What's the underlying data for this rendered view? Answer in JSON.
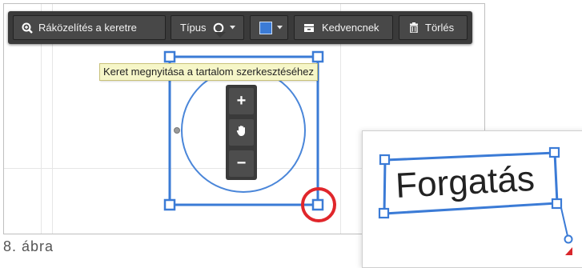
{
  "toolbar": {
    "zoom_label": "Ráközelítés a keretre",
    "type_label": "Típus",
    "favorite_label": "Kedvencnek",
    "delete_label": "Törlés",
    "fill_color": "#3b7bd6"
  },
  "tooltip": {
    "text": "Keret megnyitása a tartalom szerkesztéséhez"
  },
  "zoom_control": {
    "plus": "+",
    "minus": "−"
  },
  "inset": {
    "text": "Forgatás"
  },
  "caption": "8. ábra",
  "colors": {
    "accent": "#3b7bd6",
    "highlight": "#e0262b",
    "toolbar": "#3a3a3a"
  }
}
